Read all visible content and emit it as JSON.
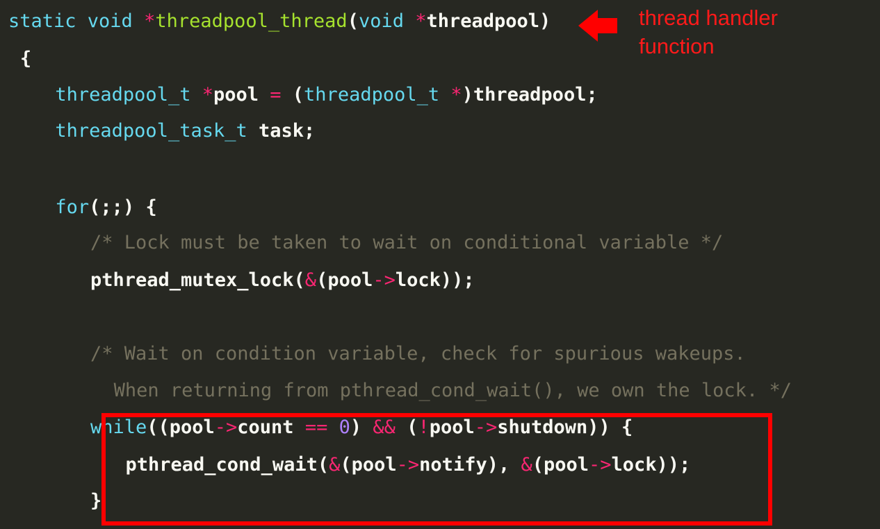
{
  "code": {
    "lines": [
      {
        "indent": 0,
        "tokens": [
          {
            "t": "static void ",
            "c": "kw"
          },
          {
            "t": "*",
            "c": "op"
          },
          {
            "t": "threadpool_thread",
            "c": "fn"
          },
          {
            "t": "(",
            "c": "tx"
          },
          {
            "t": "void ",
            "c": "kw"
          },
          {
            "t": "*",
            "c": "op"
          },
          {
            "t": "threadpool)",
            "c": "tx"
          }
        ]
      },
      {
        "indent": 1,
        "tokens": [
          {
            "t": "{",
            "c": "tx"
          }
        ]
      },
      {
        "indent": 4,
        "tokens": [
          {
            "t": "threadpool_t ",
            "c": "kw"
          },
          {
            "t": "*",
            "c": "op"
          },
          {
            "t": "pool ",
            "c": "tx"
          },
          {
            "t": "=",
            "c": "op"
          },
          {
            "t": " (",
            "c": "tx"
          },
          {
            "t": "threadpool_t ",
            "c": "kw"
          },
          {
            "t": "*",
            "c": "op"
          },
          {
            "t": ")threadpool;",
            "c": "tx"
          }
        ]
      },
      {
        "indent": 4,
        "tokens": [
          {
            "t": "threadpool_task_t ",
            "c": "kw"
          },
          {
            "t": "task;",
            "c": "tx"
          }
        ]
      },
      {
        "indent": 0,
        "tokens": []
      },
      {
        "indent": 4,
        "tokens": [
          {
            "t": "for",
            "c": "kw"
          },
          {
            "t": "(;;) {",
            "c": "tx"
          }
        ]
      },
      {
        "indent": 7,
        "tokens": [
          {
            "t": "/* Lock must be taken to wait on conditional variable */",
            "c": "cm"
          }
        ]
      },
      {
        "indent": 7,
        "tokens": [
          {
            "t": "pthread_mutex_lock(",
            "c": "tx"
          },
          {
            "t": "&",
            "c": "op"
          },
          {
            "t": "(pool",
            "c": "tx"
          },
          {
            "t": "->",
            "c": "op"
          },
          {
            "t": "lock));",
            "c": "tx"
          }
        ]
      },
      {
        "indent": 0,
        "tokens": []
      },
      {
        "indent": 7,
        "tokens": [
          {
            "t": "/* Wait on condition variable, check for spurious wakeups.",
            "c": "cm"
          }
        ]
      },
      {
        "indent": 9,
        "tokens": [
          {
            "t": "When returning from pthread_cond_wait(), we own the lock. */",
            "c": "cm"
          }
        ]
      },
      {
        "indent": 7,
        "tokens": [
          {
            "t": "while",
            "c": "kw"
          },
          {
            "t": "((pool",
            "c": "tx"
          },
          {
            "t": "->",
            "c": "op"
          },
          {
            "t": "count ",
            "c": "tx"
          },
          {
            "t": "==",
            "c": "op"
          },
          {
            "t": " ",
            "c": "tx"
          },
          {
            "t": "0",
            "c": "num"
          },
          {
            "t": ") ",
            "c": "tx"
          },
          {
            "t": "&&",
            "c": "op"
          },
          {
            "t": " (",
            "c": "tx"
          },
          {
            "t": "!",
            "c": "op"
          },
          {
            "t": "pool",
            "c": "tx"
          },
          {
            "t": "->",
            "c": "op"
          },
          {
            "t": "shutdown)) {",
            "c": "tx"
          }
        ]
      },
      {
        "indent": 10,
        "tokens": [
          {
            "t": "pthread_cond_wait(",
            "c": "tx"
          },
          {
            "t": "&",
            "c": "op"
          },
          {
            "t": "(pool",
            "c": "tx"
          },
          {
            "t": "->",
            "c": "op"
          },
          {
            "t": "notify), ",
            "c": "tx"
          },
          {
            "t": "&",
            "c": "op"
          },
          {
            "t": "(pool",
            "c": "tx"
          },
          {
            "t": "->",
            "c": "op"
          },
          {
            "t": "lock));",
            "c": "tx"
          }
        ]
      },
      {
        "indent": 7,
        "tokens": [
          {
            "t": "}",
            "c": "tx"
          }
        ]
      }
    ]
  },
  "annotation": {
    "line1": "thread handler",
    "line2": "function",
    "color": "#ff1a1a"
  },
  "highlight": {
    "color": "#ff0000"
  },
  "theme": {
    "background": "#272822",
    "keyword": "#66d9ef",
    "function": "#a6e22e",
    "operator": "#f92672",
    "number": "#ae81ff",
    "comment": "#75715e",
    "text": "#f8f8f2"
  }
}
